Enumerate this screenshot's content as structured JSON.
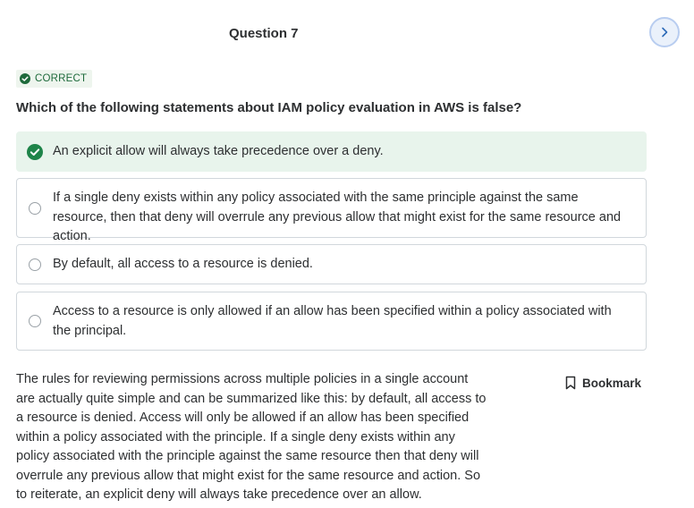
{
  "header": {
    "question_label": "Question 7"
  },
  "nav": {
    "next_icon": "chevron-right-icon"
  },
  "result": {
    "badge_text": "CORRECT",
    "badge_color": "#1e6a3b",
    "badge_icon": "check-circle-icon"
  },
  "question": {
    "text": "Which of the following statements about IAM policy evaluation in AWS is false?"
  },
  "options": [
    {
      "text": "An explicit allow will always take precedence over a deny.",
      "selected": true
    },
    {
      "text": "If a single deny exists within any policy associated with the same principle against the same resource, then that deny will overrule any previous allow that might exist for the same resource and action.",
      "selected": false
    },
    {
      "text": "By default, all access to a resource is denied.",
      "selected": false
    },
    {
      "text": "Access to a resource is only allowed if an allow has been specified within a policy associated with the principal.",
      "selected": false
    }
  ],
  "explanation": {
    "text": "The rules for reviewing permissions across multiple policies in a single account are actually quite simple and can be summarized like this: by default, all access to a resource is denied. Access will only be allowed if an allow has been specified within a policy associated with the principle. If a single deny exists within any policy associated with the principle against the same resource then that deny will overrule any previous allow that might exist for the same resource and action. So to reiterate, an explicit deny will always take precedence over an allow."
  },
  "bookmark": {
    "label": "Bookmark",
    "icon": "bookmark-icon"
  },
  "colors": {
    "correct_green": "#1e8449",
    "selected_bg": "#e8f4ec"
  }
}
